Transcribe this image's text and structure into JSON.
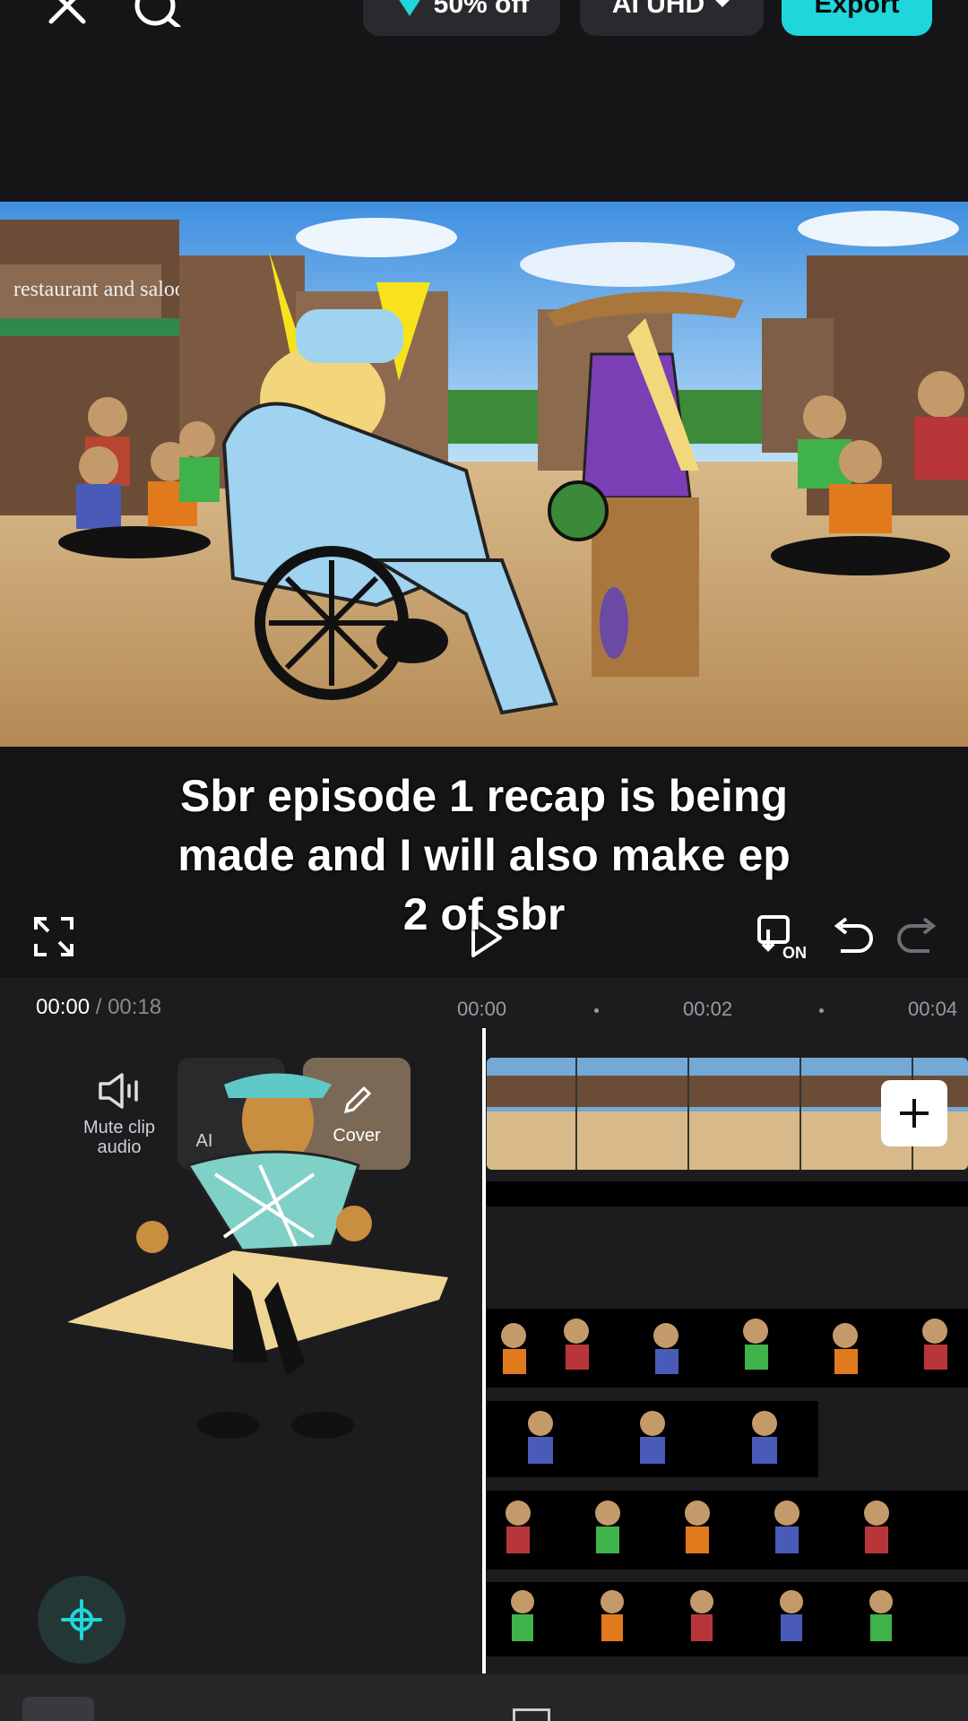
{
  "header": {
    "discount_label": "50% off",
    "resolution_label": "AI UHD",
    "export_label": "Export"
  },
  "caption": {
    "line1": "Sbr episode 1 recap is being",
    "line2": "made and I will also make ep",
    "line3": "2 of sbr"
  },
  "preview": {
    "sign_text": "restaurant and saloon"
  },
  "controls": {
    "autosave_badge": "ON"
  },
  "timeline": {
    "current_time": "00:00",
    "separator": "/",
    "total_time": "00:18",
    "ruler": [
      "00:00",
      "00:02",
      "00:04"
    ]
  },
  "tools": {
    "mute_label": "Mute clip audio",
    "ai_label": "AI",
    "cover_label": "Cover"
  },
  "colors": {
    "accent": "#1fd6da",
    "background": "#151517",
    "timeline_bg": "#1c1c1f"
  }
}
